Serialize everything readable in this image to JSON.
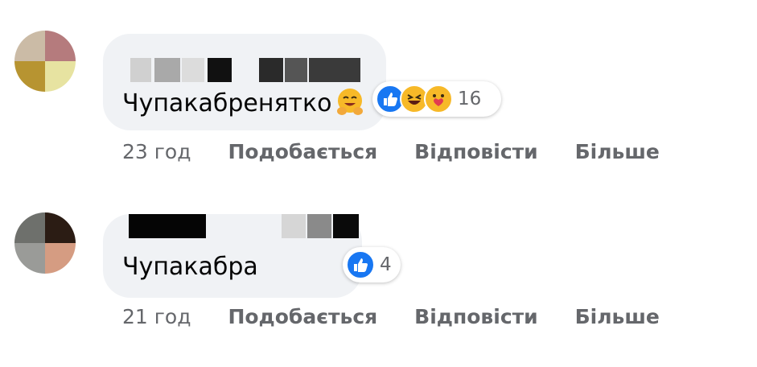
{
  "comments": [
    {
      "text": "Чупакабренятко",
      "inline_emoji": "smiling-face-with-open-hands-emoji",
      "reactions": [
        "like",
        "haha",
        "care"
      ],
      "reaction_count": "16",
      "time": "23 год",
      "actions": {
        "like": "Подобається",
        "reply": "Відповісти",
        "more": "Більше"
      }
    },
    {
      "text": "Чупакабра",
      "reactions": [
        "like"
      ],
      "reaction_count": "4",
      "time": "21 год",
      "actions": {
        "like": "Подобається",
        "reply": "Відповісти",
        "more": "Більше"
      }
    }
  ],
  "colors": {
    "bubble": "#f0f2f5",
    "text": "#050505",
    "secondary": "#65676b",
    "like_blue": "#1877f2",
    "emoji_yellow": "#f7b928"
  }
}
